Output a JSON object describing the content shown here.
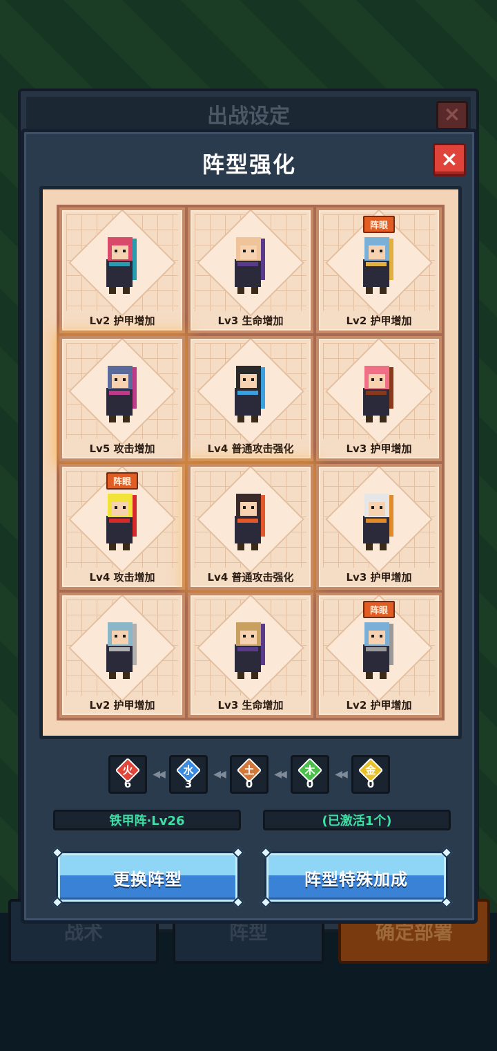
{
  "background_panel": {
    "title": "出战设定",
    "tabs": [
      "战术",
      "阵型",
      "确定部署"
    ]
  },
  "dialog": {
    "title": "阵型强化",
    "close_icon": "×"
  },
  "formation_cards": [
    {
      "label": "Lv2 护甲增加",
      "badge": "",
      "hero_color": "#d94a6a",
      "accent": "#2a9ab0"
    },
    {
      "label": "Lv3 生命增加",
      "badge": "",
      "hero_color": "#f0c49a",
      "accent": "#5a3a8a"
    },
    {
      "label": "Lv2 护甲增加",
      "badge": "阵眼",
      "hero_color": "#7ab0d8",
      "accent": "#e0b040"
    },
    {
      "label": "Lv5 攻击增加",
      "badge": "",
      "hero_color": "#5a6a9a",
      "accent": "#c03a8a"
    },
    {
      "label": "Lv4 普通攻击强化",
      "badge": "",
      "hero_color": "#2a2a2a",
      "accent": "#3aa0e0"
    },
    {
      "label": "Lv3 护甲增加",
      "badge": "",
      "hero_color": "#ef6f86",
      "accent": "#8a3a1a"
    },
    {
      "label": "Lv4 攻击增加",
      "badge": "阵眼",
      "hero_color": "#f2e33a",
      "accent": "#d62a2a"
    },
    {
      "label": "Lv4 普通攻击强化",
      "badge": "",
      "hero_color": "#3a2a2a",
      "accent": "#e2582a"
    },
    {
      "label": "Lv3 护甲增加",
      "badge": "",
      "hero_color": "#e6e6e6",
      "accent": "#e08a2a"
    },
    {
      "label": "Lv2 护甲增加",
      "badge": "",
      "hero_color": "#8ab6c8",
      "accent": "#b0b0b0"
    },
    {
      "label": "Lv3 生命增加",
      "badge": "",
      "hero_color": "#c8a060",
      "accent": "#5a3a8a"
    },
    {
      "label": "Lv2 护甲增加",
      "badge": "阵眼",
      "hero_color": "#7ab0d8",
      "accent": "#9a9a9a"
    }
  ],
  "elements": [
    {
      "glyph": "火",
      "count": "6",
      "color": "#e2463a"
    },
    {
      "glyph": "水",
      "count": "3",
      "color": "#3a8ae2"
    },
    {
      "glyph": "土",
      "count": "0",
      "color": "#d2783a"
    },
    {
      "glyph": "木",
      "count": "0",
      "color": "#4ac04a"
    },
    {
      "glyph": "金",
      "count": "0",
      "color": "#e8c02a"
    }
  ],
  "info": {
    "formation_level": "铁甲阵·Lv26",
    "activated": "(已激活1个)"
  },
  "buttons": {
    "change_formation": "更换阵型",
    "special_bonus": "阵型特殊加成"
  }
}
